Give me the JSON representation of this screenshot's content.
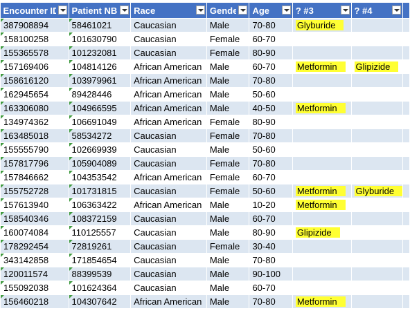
{
  "columns": [
    "Encounter ID",
    "Patient NBR",
    "Race",
    "Gender",
    "Age",
    "? #3",
    "? #4",
    ""
  ],
  "rows": [
    {
      "enc": "387908894",
      "pat": "58461021",
      "race": "Caucasian",
      "gender": "Male",
      "age": "70-80",
      "m3": "Glyburide",
      "m4": ""
    },
    {
      "enc": "158100258",
      "pat": "101630790",
      "race": "Caucasian",
      "gender": "Female",
      "age": "60-70",
      "m3": "",
      "m4": ""
    },
    {
      "enc": "155365578",
      "pat": "101232081",
      "race": "Caucasian",
      "gender": "Female",
      "age": "80-90",
      "m3": "",
      "m4": ""
    },
    {
      "enc": "157169406",
      "pat": "104814126",
      "race": "African American",
      "gender": "Male",
      "age": "60-70",
      "m3": "Metformin",
      "m4": "Glipizide"
    },
    {
      "enc": "158616120",
      "pat": "103979961",
      "race": "African American",
      "gender": "Male",
      "age": "70-80",
      "m3": "",
      "m4": ""
    },
    {
      "enc": "162945654",
      "pat": "89428446",
      "race": "African American",
      "gender": "Male",
      "age": "50-60",
      "m3": "",
      "m4": ""
    },
    {
      "enc": "163306080",
      "pat": "104966595",
      "race": "African American",
      "gender": "Male",
      "age": "40-50",
      "m3": "Metformin",
      "m4": ""
    },
    {
      "enc": "134974362",
      "pat": "106691049",
      "race": "African American",
      "gender": "Female",
      "age": "80-90",
      "m3": "",
      "m4": ""
    },
    {
      "enc": "163485018",
      "pat": "58534272",
      "race": "Caucasian",
      "gender": "Female",
      "age": "70-80",
      "m3": "",
      "m4": ""
    },
    {
      "enc": "155555790",
      "pat": "102669939",
      "race": "Caucasian",
      "gender": "Male",
      "age": "50-60",
      "m3": "",
      "m4": ""
    },
    {
      "enc": "157817796",
      "pat": "105904089",
      "race": "Caucasian",
      "gender": "Female",
      "age": "70-80",
      "m3": "",
      "m4": ""
    },
    {
      "enc": "157846662",
      "pat": "104353542",
      "race": "African American",
      "gender": "Female",
      "age": "60-70",
      "m3": "",
      "m4": ""
    },
    {
      "enc": "155752728",
      "pat": "101731815",
      "race": "Caucasian",
      "gender": "Female",
      "age": "50-60",
      "m3": "Metformin",
      "m4": "Glyburide"
    },
    {
      "enc": "157613940",
      "pat": "106363422",
      "race": "African American",
      "gender": "Male",
      "age": "10-20",
      "m3": "Metformin",
      "m4": ""
    },
    {
      "enc": "158540346",
      "pat": "108372159",
      "race": "Caucasian",
      "gender": "Male",
      "age": "60-70",
      "m3": "",
      "m4": ""
    },
    {
      "enc": "160074084",
      "pat": "110125557",
      "race": "Caucasian",
      "gender": "Male",
      "age": "80-90",
      "m3": "Glipizide",
      "m4": ""
    },
    {
      "enc": "178292454",
      "pat": "72819261",
      "race": "Caucasian",
      "gender": "Female",
      "age": "30-40",
      "m3": "",
      "m4": ""
    },
    {
      "enc": "343142858",
      "pat": "171854654",
      "race": "Caucasian",
      "gender": "Male",
      "age": "70-80",
      "m3": "",
      "m4": ""
    },
    {
      "enc": "120011574",
      "pat": "88399539",
      "race": "Caucasian",
      "gender": "Male",
      "age": "90-100",
      "m3": "",
      "m4": ""
    },
    {
      "enc": "155092038",
      "pat": "101624364",
      "race": "Caucasian",
      "gender": "Male",
      "age": "60-70",
      "m3": "",
      "m4": ""
    },
    {
      "enc": "156460218",
      "pat": "104307642",
      "race": "African American",
      "gender": "Male",
      "age": "70-80",
      "m3": "Metformin",
      "m4": ""
    }
  ],
  "highlight_color": "#ffff33",
  "header_color": "#4472c4",
  "band_color": "#dce6f1"
}
